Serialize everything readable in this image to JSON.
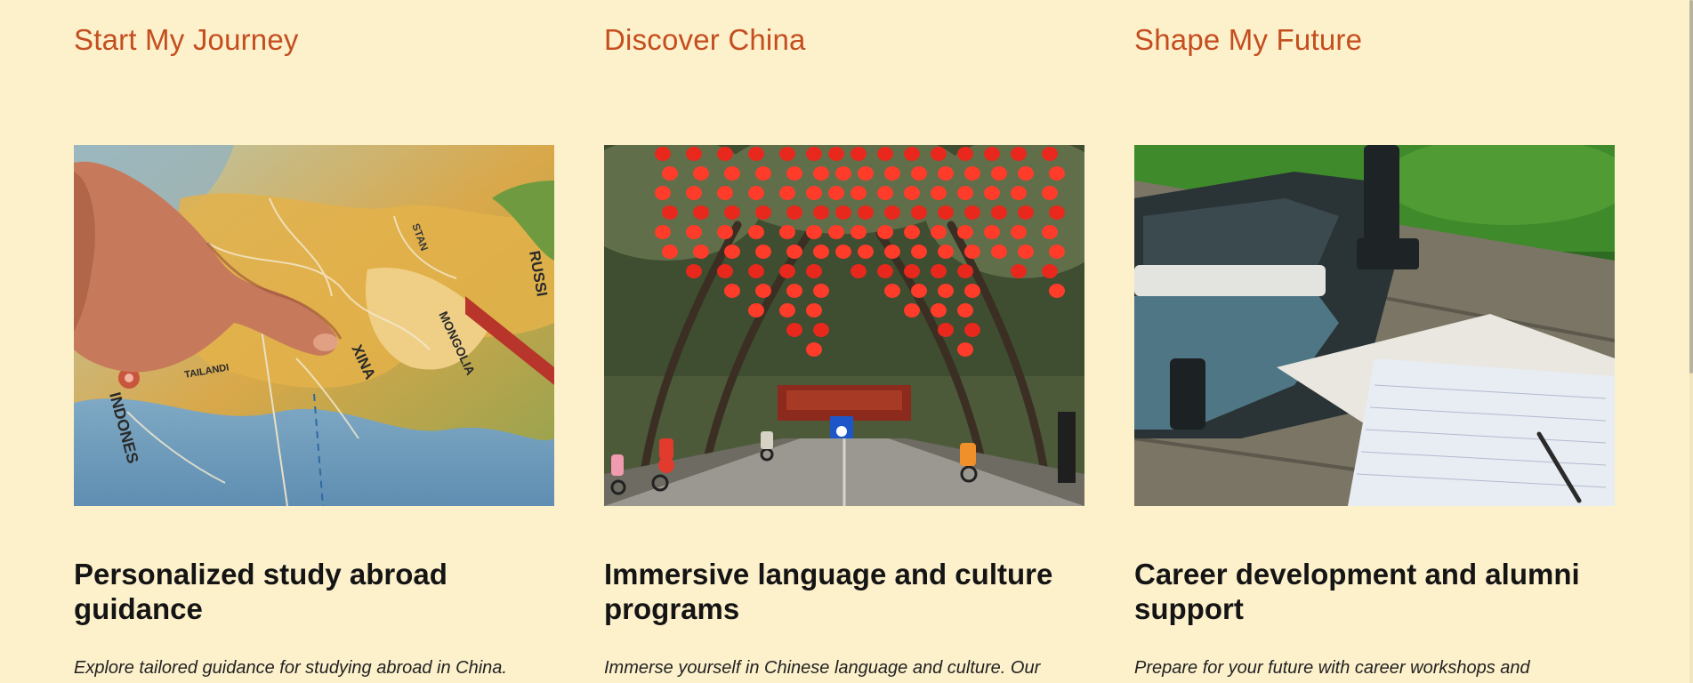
{
  "columns": [
    {
      "title": "Start My Journey",
      "image_alt": "Finger pointing at China on a world map",
      "map_labels": [
        "XINA",
        "MONGOLIA",
        "TAILANDI",
        "INDONES",
        "RUSSI",
        "STAN"
      ],
      "heading": "Personalized study abroad guidance",
      "description": "Explore tailored guidance for studying abroad in China."
    },
    {
      "title": "Discover China",
      "image_alt": "Street lined with red lanterns and cyclists",
      "heading": "Immersive language and culture programs",
      "description": "Immerse yourself in Chinese language and culture. Our"
    },
    {
      "title": "Shape My Future",
      "image_alt": "Open bag, book and notebook on a wooden table",
      "heading": "Career development and alumni support",
      "description": "Prepare for your future with career workshops and"
    }
  ],
  "colors": {
    "background": "#fdf1cc",
    "title": "#c44e1f",
    "heading": "#141414"
  }
}
